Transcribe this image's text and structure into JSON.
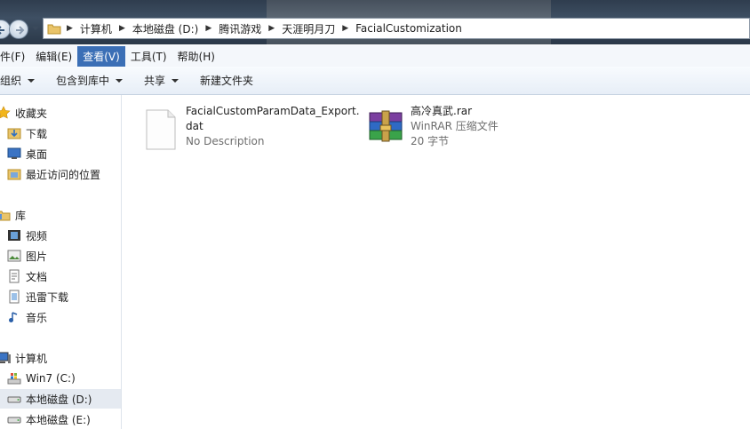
{
  "address": {
    "crumbs": [
      "计算机",
      "本地磁盘 (D:)",
      "腾讯游戏",
      "天涯明月刀",
      "FacialCustomization"
    ]
  },
  "menu": [
    "件(F)",
    "编辑(E)",
    "查看(V)",
    "工具(T)",
    "帮助(H)"
  ],
  "toolbar": {
    "organize": "组织",
    "include": "包含到库中",
    "share": "共享",
    "new_folder": "新建文件夹"
  },
  "nav": {
    "favorites": "收藏夹",
    "downloads": "下载",
    "desktop": "桌面",
    "recent": "最近访问的位置",
    "libraries": "库",
    "videos": "视频",
    "pictures": "图片",
    "documents": "文档",
    "xunlei": "迅雷下载",
    "music": "音乐",
    "computer": "计算机",
    "drive_c": "Win7 (C:)",
    "drive_d": "本地磁盘 (D:)",
    "drive_e": "本地磁盘 (E:)"
  },
  "files": [
    {
      "name_line1": "FacialCustomParamData_Export.",
      "name_line2": "dat",
      "desc": "No Description",
      "icon": "blank-document-icon"
    },
    {
      "name": "高冷真武.rar",
      "type": "WinRAR 压缩文件",
      "size": "20 字节",
      "icon": "winrar-archive-icon"
    }
  ],
  "colors": {
    "menu_active": "#3b6fb6",
    "toolbar_top": "#f8fbfe",
    "toolbar_bottom": "#e7eef7"
  }
}
